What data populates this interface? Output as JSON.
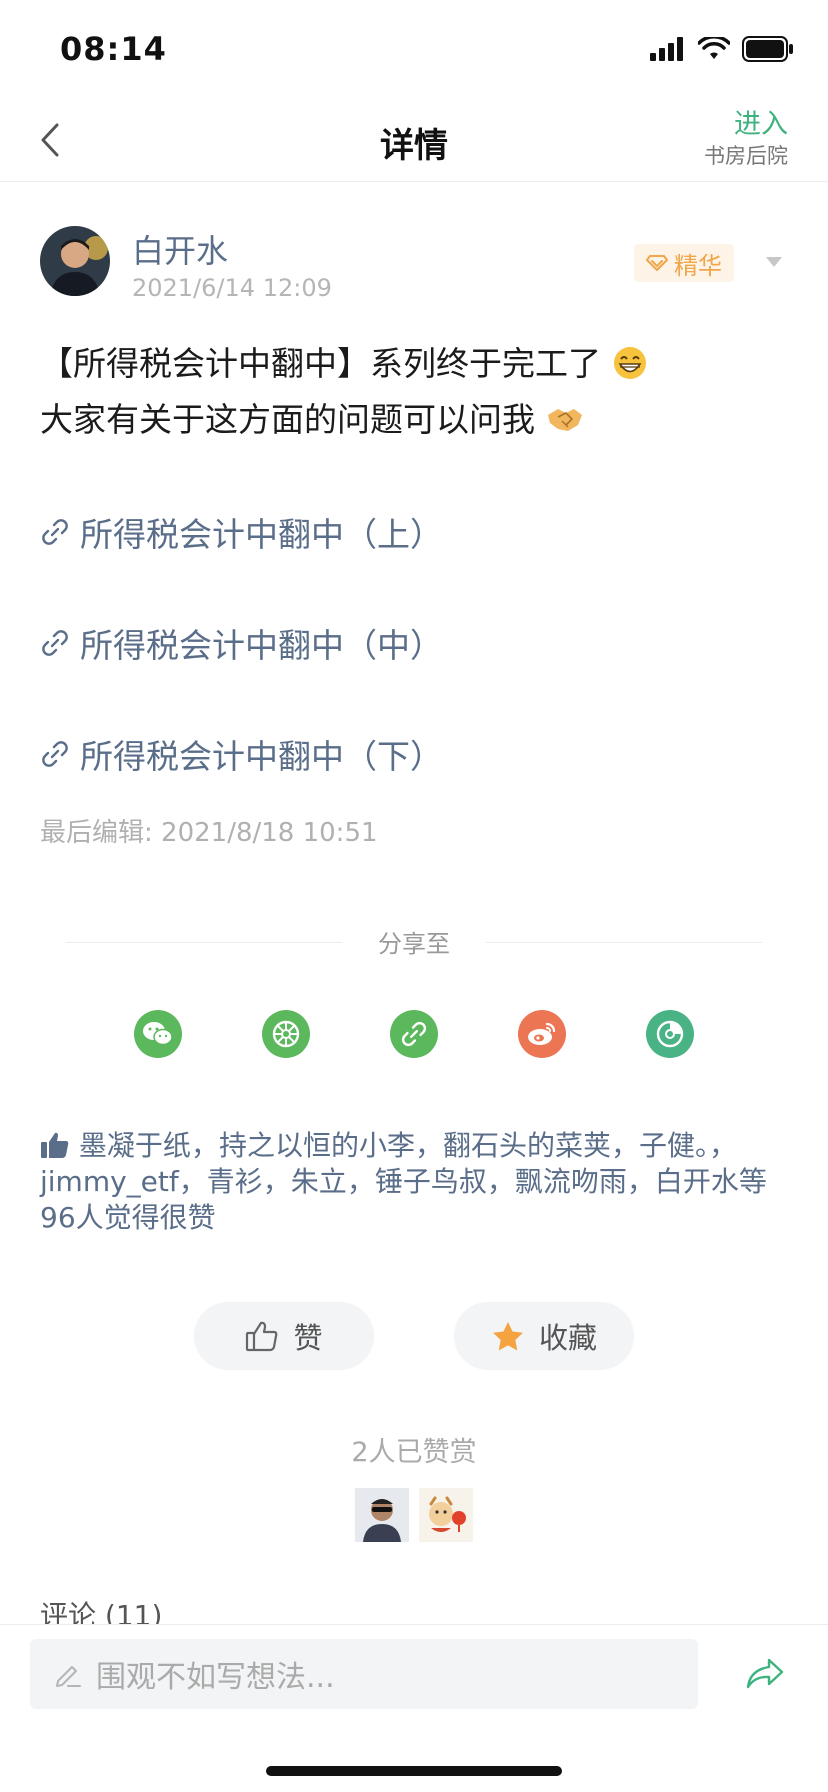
{
  "status": {
    "time": "08:14"
  },
  "nav": {
    "title": "详情",
    "enter_label": "进入",
    "enter_sub": "书房后院"
  },
  "post": {
    "author": "白开水",
    "time": "2021/6/14 12:09",
    "badge": "精华",
    "content_line1": "【所得税会计中翻中】系列终于完工了",
    "content_line2": "大家有关于这方面的问题可以问我",
    "links": [
      "所得税会计中翻中（上）",
      "所得税会计中翻中（中）",
      "所得税会计中翻中（下）"
    ],
    "edited": "最后编辑: 2021/8/18 10:51"
  },
  "share": {
    "title": "分享至",
    "targets": [
      {
        "name": "wechat-icon",
        "color": "#5cb85c"
      },
      {
        "name": "moments-icon",
        "color": "#5cb85c"
      },
      {
        "name": "link-icon",
        "color": "#5cb85c"
      },
      {
        "name": "weibo-icon",
        "color": "#ec7654"
      },
      {
        "name": "browser-icon",
        "color": "#4ab385"
      }
    ]
  },
  "likes": {
    "users": [
      "墨凝于纸",
      "持之以恒的小李",
      "翻石头的菜荚",
      "子健。",
      "jimmy_etf",
      "青衫",
      "朱立",
      "锤子鸟叔",
      "飘流吻雨"
    ],
    "last": "白开水等96人觉得很赞"
  },
  "actions": {
    "like_label": "赞",
    "favorite_label": "收藏"
  },
  "tips": {
    "count_text": "2人已赞赏"
  },
  "comments": {
    "title": "评论 (11)"
  },
  "bottom": {
    "placeholder": "围观不如写想法..."
  },
  "colors": {
    "accent": "#3fb37f",
    "link": "#5a6e8a",
    "badge": "#f0a64a"
  }
}
